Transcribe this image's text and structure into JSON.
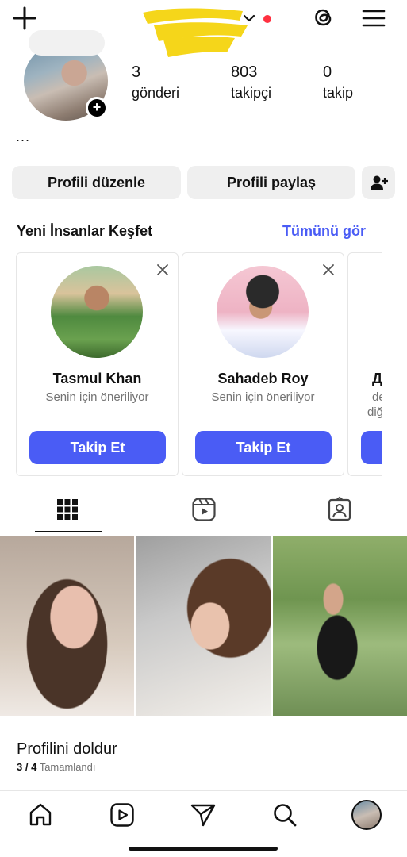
{
  "header": {
    "username_hidden": true,
    "notification_dot_color": "#ff3040",
    "icons": [
      "plus-icon",
      "chevron-down-icon",
      "threads-icon",
      "menu-icon"
    ]
  },
  "profile": {
    "stats": [
      {
        "value": "3",
        "label": "gönderi"
      },
      {
        "value": "803",
        "label": "takipçi"
      },
      {
        "value": "0",
        "label": "takip"
      }
    ],
    "bio_ellipsis": "...",
    "add_story_symbol": "+"
  },
  "actions": {
    "edit_label": "Profili düzenle",
    "share_label": "Profili paylaş"
  },
  "discover": {
    "title": "Yeni İnsanlar Keşfet",
    "see_all": "Tümünü gör",
    "accent": "#4a5cf5",
    "cards": [
      {
        "name": "Tasmul Khan",
        "subtitle": "Senin için öneriliyor",
        "button": "Takip Et"
      },
      {
        "name": "Sahadeb Roy",
        "subtitle": "Senin için öneriliyor",
        "button": "Takip Et"
      },
      {
        "name": "Д",
        "subtitle": "de",
        "subtitle2": "diğ",
        "button": ""
      }
    ]
  },
  "tabs": [
    "grid-icon",
    "reels-icon",
    "tagged-icon"
  ],
  "completion": {
    "title": "Profilini doldur",
    "progress": "3 / 4",
    "status": "Tamamlandı"
  },
  "bottom_nav": [
    "home-icon",
    "reels-icon",
    "send-icon",
    "search-icon",
    "profile-avatar"
  ]
}
